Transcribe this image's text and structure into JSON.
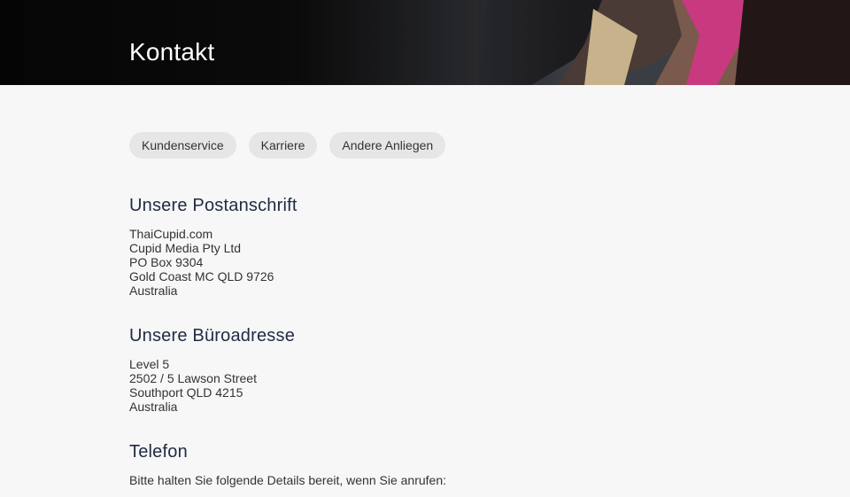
{
  "header": {
    "title": "Kontakt"
  },
  "tabs": [
    {
      "label": "Kundenservice"
    },
    {
      "label": "Karriere"
    },
    {
      "label": "Andere Anliegen"
    }
  ],
  "postal": {
    "heading": "Unsere Postanschrift",
    "lines": [
      "ThaiCupid.com",
      "Cupid Media Pty Ltd",
      "PO Box 9304",
      "Gold Coast MC QLD 9726",
      "Australia"
    ]
  },
  "office": {
    "heading": "Unsere Büroadresse",
    "lines": [
      "Level 5",
      "2502 / 5 Lawson Street",
      "Southport QLD 4215",
      "Australia"
    ]
  },
  "phone": {
    "heading": "Telefon",
    "intro": "Bitte halten Sie folgende Details bereit, wenn Sie anrufen:"
  },
  "colors": {
    "heading": "#1f2a44",
    "background": "#f7f7f7",
    "tab_bg": "#e6e6e6"
  }
}
